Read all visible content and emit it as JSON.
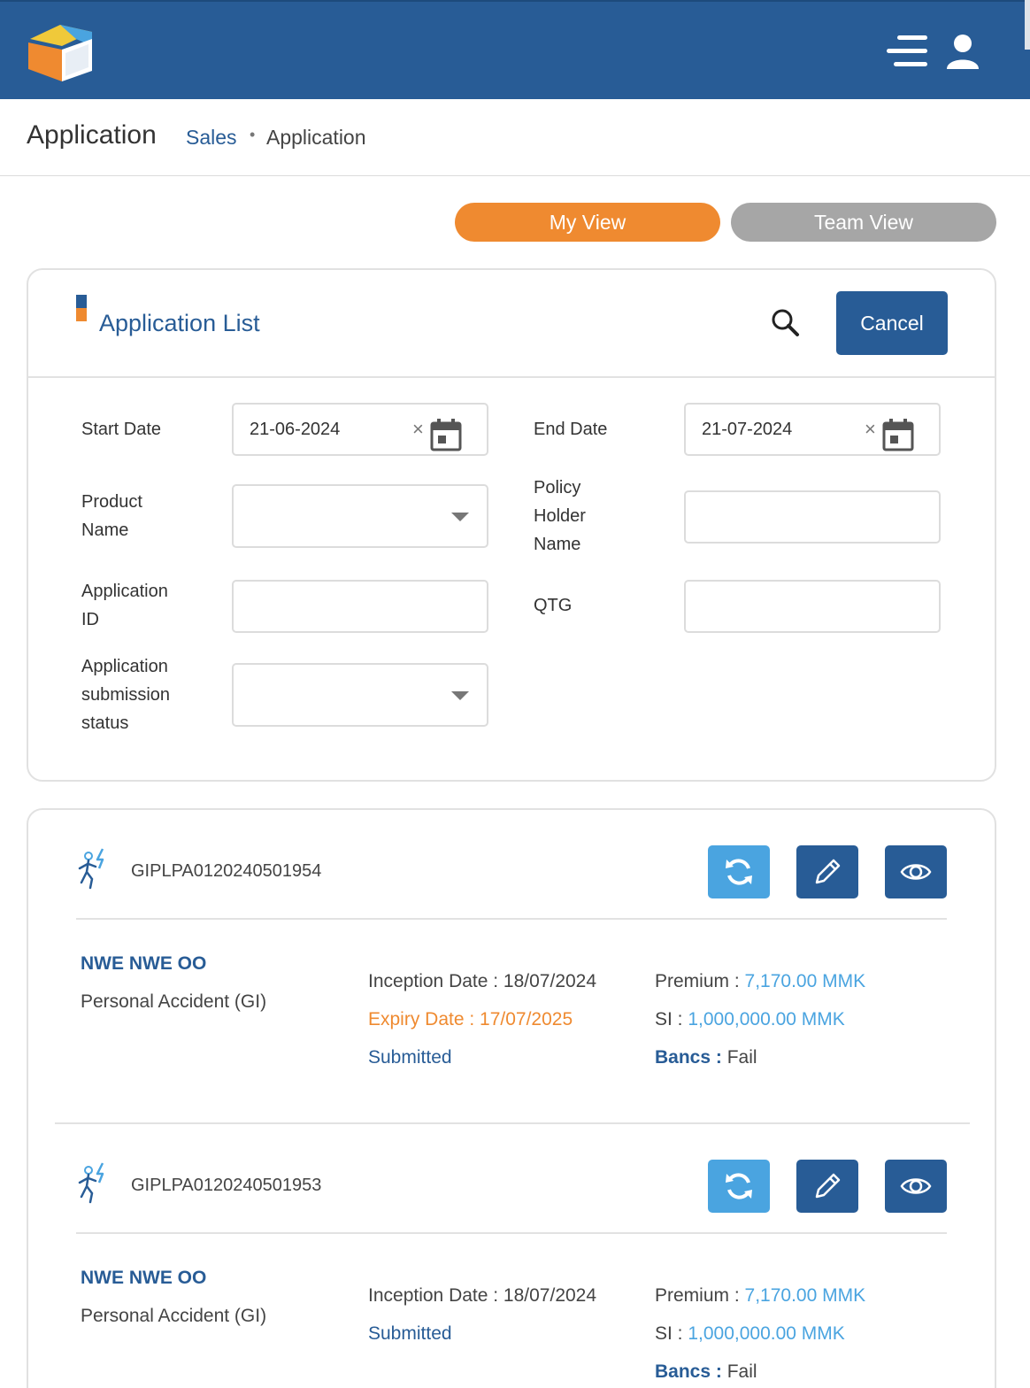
{
  "header": {
    "page_title": "Application",
    "breadcrumb": {
      "parent": "Sales",
      "separator": "•",
      "current": "Application"
    }
  },
  "view_toggle": {
    "my_view": "My View",
    "team_view": "Team View"
  },
  "filter_card": {
    "title": "Application List",
    "cancel_label": "Cancel",
    "fields": {
      "start_date_label": "Start Date",
      "start_date_value": "21-06-2024",
      "end_date_label": "End Date",
      "end_date_value": "21-07-2024",
      "product_name_label_l1": "Product",
      "product_name_label_l2": "Name",
      "policy_holder_label_l1": "Policy",
      "policy_holder_label_l2": "Holder",
      "policy_holder_label_l3": "Name",
      "application_id_label_l1": "Application",
      "application_id_label_l2": "ID",
      "qtg_label": "QTG",
      "submission_status_label_l1": "Application",
      "submission_status_label_l2": "submission",
      "submission_status_label_l3": "status",
      "clear_glyph": "×"
    }
  },
  "applications": [
    {
      "id": "GIPLPA0120240501954",
      "holder": "NWE NWE OO",
      "product": "Personal Accident (GI)",
      "inception": "Inception Date : 18/07/2024",
      "expiry": "Expiry Date : 17/07/2025",
      "status": "Submitted",
      "premium_label": "Premium : ",
      "premium_value": "7,170.00 MMK",
      "si_label": "SI : ",
      "si_value": "1,000,000.00 MMK",
      "bancs_label": "Bancs :",
      "bancs_value": " Fail"
    },
    {
      "id": "GIPLPA0120240501953",
      "holder": "NWE NWE OO",
      "product": "Personal Accident (GI)",
      "inception": "Inception Date : 18/07/2024",
      "status": "Submitted",
      "premium_label": "Premium : ",
      "premium_value": "7,170.00 MMK",
      "si_label": "SI : ",
      "si_value": "1,000,000.00 MMK",
      "bancs_label": "Bancs :",
      "bancs_value": " Fail"
    }
  ],
  "icons": {
    "logo": "app-logo",
    "menu": "menu-icon",
    "user": "user-icon",
    "search": "search-icon",
    "calendar": "calendar-icon",
    "dropdown": "chevron-down-icon",
    "product_type": "personal-accident-icon",
    "refresh": "refresh-icon",
    "edit": "pencil-icon",
    "view": "eye-icon"
  },
  "colors": {
    "primary": "#285c96",
    "accent": "#ef8a30",
    "light_blue": "#4aa4e0",
    "inactive": "#a6a6a6"
  }
}
